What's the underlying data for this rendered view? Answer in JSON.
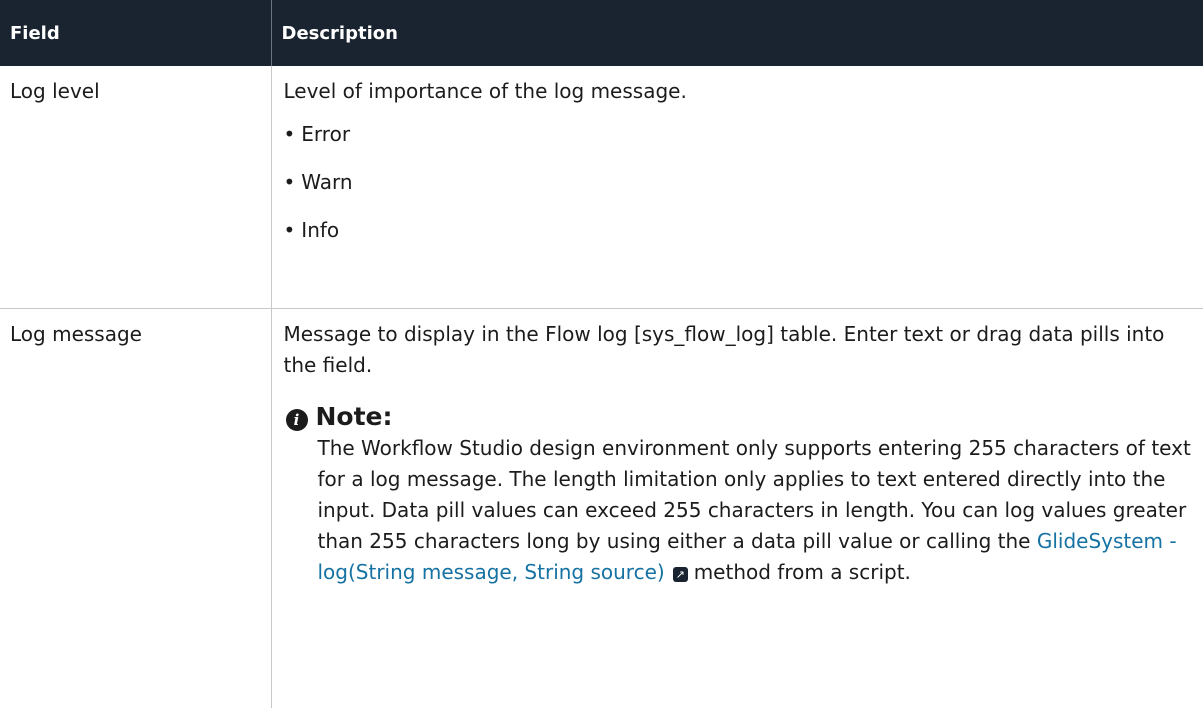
{
  "table": {
    "headers": [
      "Field",
      "Description"
    ],
    "rows": [
      {
        "field": "Log level",
        "description": "Level of importance of the log message.",
        "options": [
          "Error",
          "Warn",
          "Info"
        ]
      },
      {
        "field": "Log message",
        "description": "Message to display in the Flow log [sys_flow_log] table. Enter text or drag data pills into the field.",
        "note": {
          "title": "Note:",
          "text_before_link": "The Workflow Studio design environment only supports entering 255 characters of text for a log message. The length limitation only applies to text entered directly into the input. Data pill values can exceed 255 characters in length. You can log values greater than 255 characters long by using either a data pill value or calling the",
          "link_text": "GlideSystem - log(String message, String source)",
          "text_after_link": "method from a script."
        }
      }
    ]
  },
  "icons": {
    "bullet": "•",
    "note_icon": "info-icon",
    "note_glyph": "i",
    "external_link_icon": "external-link-icon",
    "external_link_glyph": "↗"
  },
  "colors": {
    "header_bg": "#1a2430",
    "link": "#1672a3"
  }
}
